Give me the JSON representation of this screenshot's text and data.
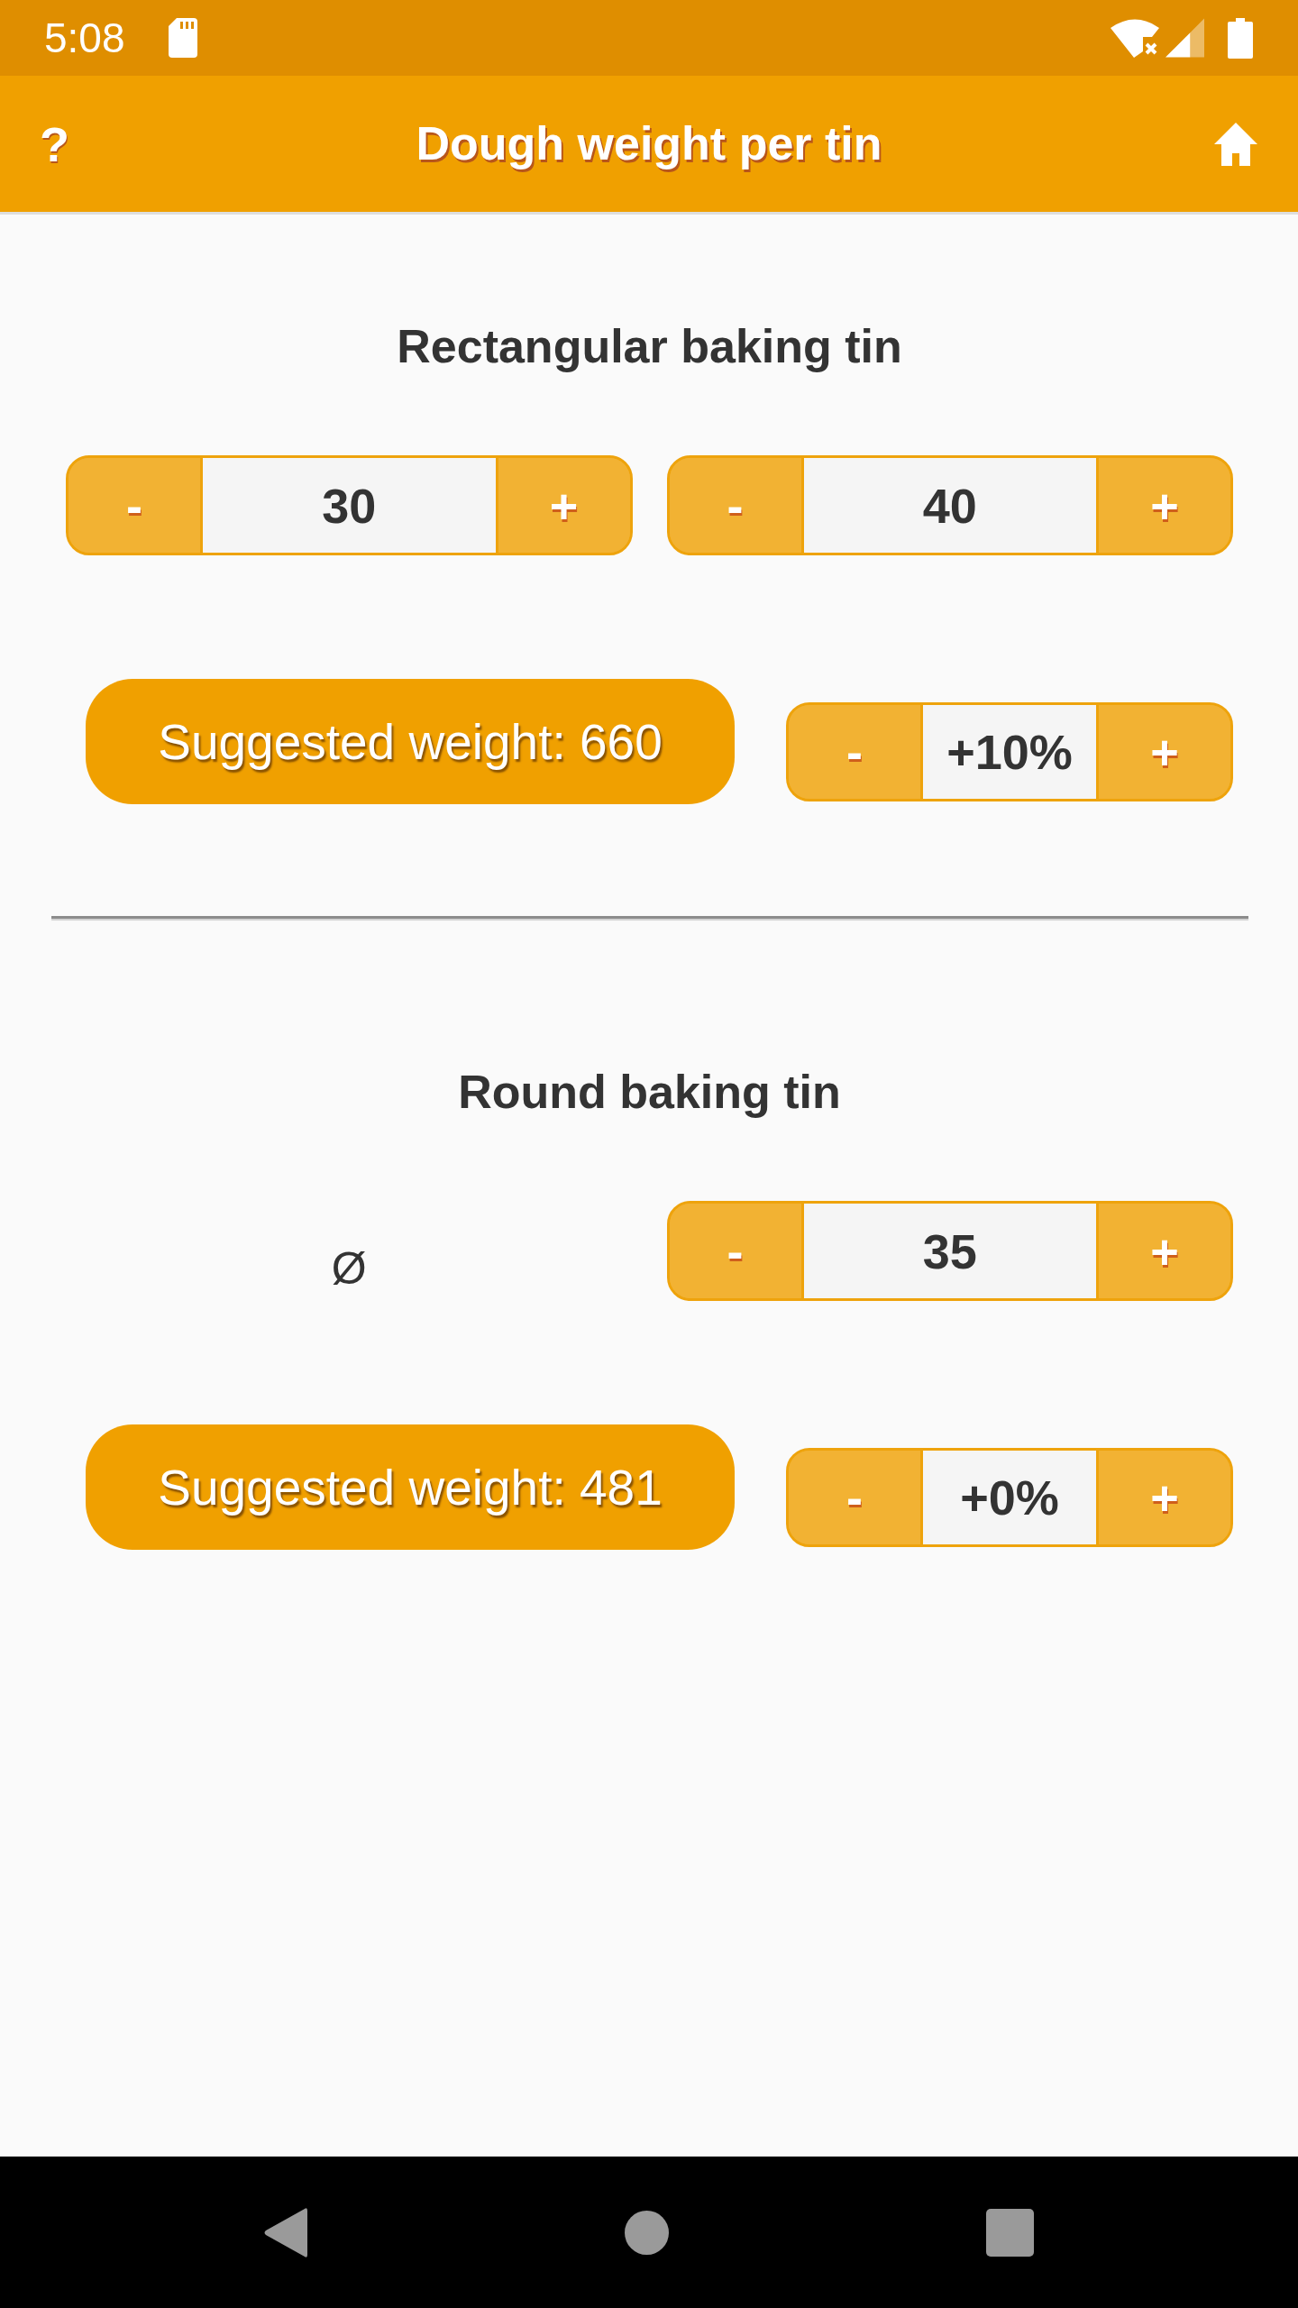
{
  "status_bar": {
    "time": "5:08"
  },
  "app_bar": {
    "help": "?",
    "title": "Dough weight per tin"
  },
  "sections": [
    {
      "heading": "Rectangular baking tin",
      "inputs": [
        {
          "kind": "stepper",
          "decrement": "-",
          "value": "30",
          "increment": "+"
        },
        {
          "kind": "stepper",
          "decrement": "-",
          "value": "40",
          "increment": "+"
        }
      ],
      "suggestion": "Suggested weight: 660",
      "adjustment": {
        "decrement": "-",
        "value": "+10%",
        "increment": "+"
      }
    },
    {
      "heading": "Round baking tin",
      "inputs": [
        {
          "kind": "symbol",
          "text": "Ø"
        },
        {
          "kind": "stepper",
          "decrement": "-",
          "value": "35",
          "increment": "+"
        }
      ],
      "suggestion": "Suggested weight: 481",
      "adjustment": {
        "decrement": "-",
        "value": "+0%",
        "increment": "+"
      }
    }
  ]
}
